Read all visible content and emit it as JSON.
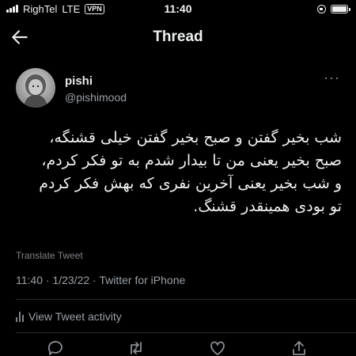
{
  "status_bar": {
    "carrier": "RighTel",
    "network": "LTE",
    "vpn": "VPN",
    "time": "11:40"
  },
  "header": {
    "title": "Thread"
  },
  "tweet": {
    "author_name": "pishi",
    "author_handle": "@pishimood",
    "text_lines": [
      "شب بخیر گفتن و صبح بخیر گفتن خیلی قشنگه،",
      "صبح بخیر یعنی من تا بیدار شدم به تو فکر کردم،",
      "و شب بخیر یعنی آخرین نفری که بهش فکر کردم",
      "تو بودی همینقدر قشنگ."
    ],
    "translate_label": "Translate Tweet",
    "meta": "11:40 · 1/23/22 · Twitter for iPhone",
    "activity_label": "View Tweet activity"
  },
  "icons": {
    "back": "arrow-left-icon",
    "more": "more-horizontal-icon",
    "activity": "bar-chart-icon",
    "reply": "reply-icon",
    "retweet": "retweet-icon",
    "like": "heart-icon",
    "share": "share-icon"
  },
  "colors": {
    "background": "#000000",
    "text_primary": "#e7e9ea",
    "text_secondary": "#9aa0a6",
    "divider": "#26292c"
  }
}
